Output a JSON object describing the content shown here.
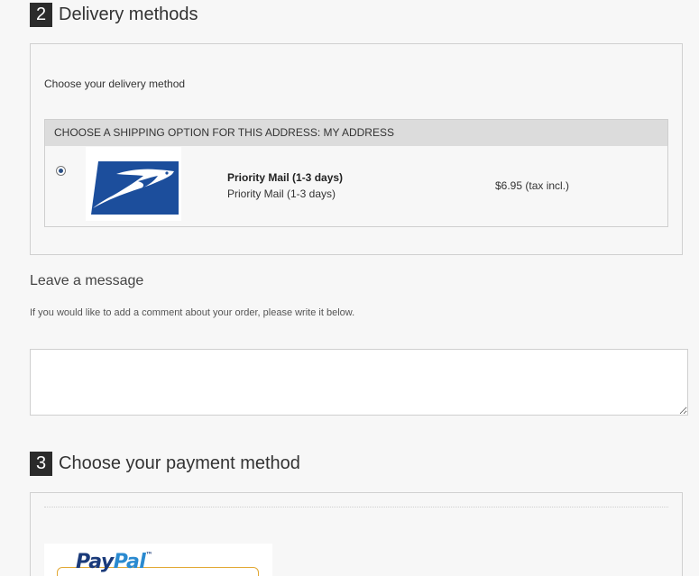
{
  "delivery": {
    "step_number": "2",
    "title": "Delivery methods",
    "intro": "Choose your delivery method",
    "table_header": "CHOOSE A SHIPPING OPTION FOR THIS ADDRESS: MY ADDRESS",
    "option": {
      "carrier_logo": "usps-eagle-logo",
      "name_bold": "Priority Mail (1-3 days)",
      "name_sub": "Priority Mail (1-3 days)",
      "price": "$6.95 (tax incl.)",
      "selected": true
    }
  },
  "message": {
    "title": "Leave a message",
    "hint": "If you would like to add a comment about your order, please write it below.",
    "value": "",
    "placeholder": ""
  },
  "payment": {
    "step_number": "3",
    "title": "Choose your payment method",
    "paypal": {
      "wordmark_pay": "Pay",
      "wordmark_pal": "Pal",
      "trademark": "™"
    }
  },
  "colors": {
    "page_background": "#f7f7f7",
    "step_badge": "#2b2b2b",
    "table_header_bg": "#dcdcdc",
    "usps_blue": "#1c4e9c",
    "paypal_dark_blue": "#1a3a7a",
    "paypal_light_blue": "#2a8ad0",
    "paypal_button_border": "#e2a834"
  }
}
